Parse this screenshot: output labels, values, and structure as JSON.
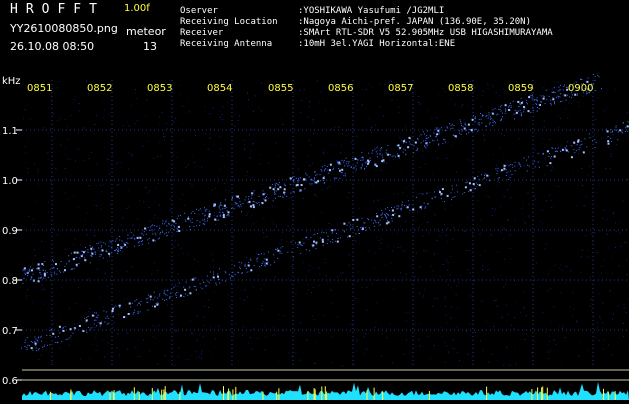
{
  "header": {
    "app_title": "HROFFT",
    "version": "1.00f",
    "filename": "YY2610080850.png",
    "datetime": "26.10.08 08:50",
    "count_label": "meteor",
    "count_value": "13"
  },
  "station_info": [
    {
      "key": "Oserver",
      "value": ":YOSHIKAWA Yasufumi /JG2MLI"
    },
    {
      "key": "Receiving Location",
      "value": ":Nagoya Aichi-pref. JAPAN (136.90E, 35.20N)"
    },
    {
      "key": "Receiver",
      "value": ":SMArt RTL-SDR V5 52.905MHz USB HIGASHIMURAYAMA"
    },
    {
      "key": "Receiving Antenna",
      "value": ":10mH 3el.YAGI Horizontal:ENE"
    }
  ],
  "colors": {
    "background": "#000000",
    "grid": "#1e3a8c",
    "time_label": "#ffff40",
    "axis_text": "#ffffff",
    "signal": "#3c6cff",
    "spectrum": "#20e0ff"
  },
  "plot": {
    "y_unit": "kHz",
    "y_ticks": [
      "1.1",
      "1.0",
      "0.9",
      "0.8",
      "0.7",
      "0.6"
    ],
    "time_labels": [
      "0851",
      "0852",
      "0853",
      "0854",
      "0855",
      "0856",
      "0857",
      "0858",
      "0859",
      "0900"
    ]
  }
}
